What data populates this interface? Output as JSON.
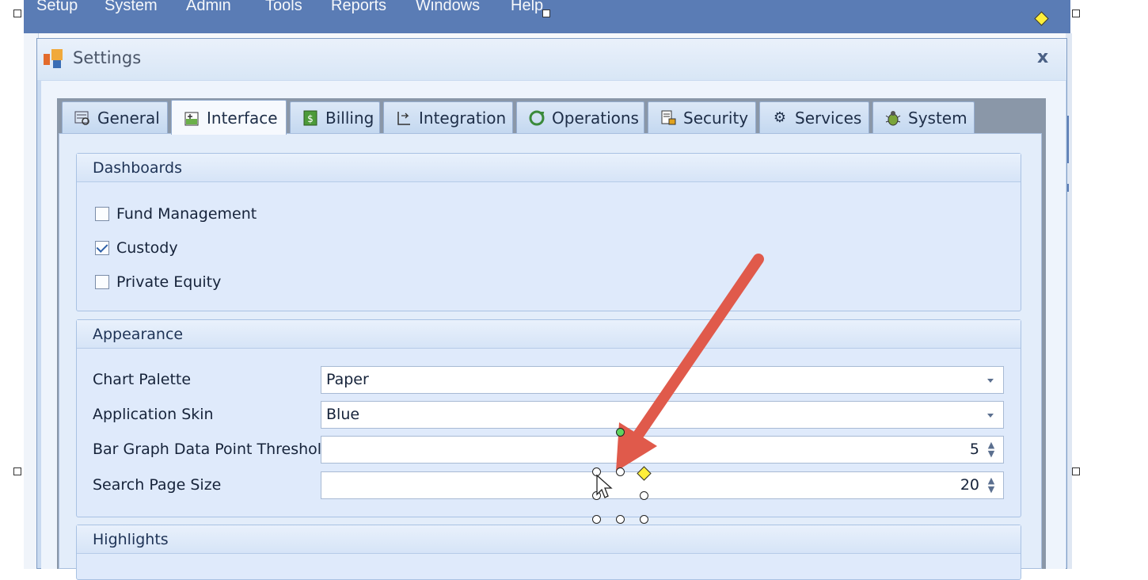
{
  "menubar": {
    "items": [
      "Setup",
      "System",
      "Admin",
      "Tools",
      "Reports",
      "Windows",
      "Help"
    ]
  },
  "dialog": {
    "title": "Settings",
    "close_glyph": "x"
  },
  "tabs": [
    {
      "label": "General",
      "icon": "general-settings-icon"
    },
    {
      "label": "Interface",
      "icon": "interface-icon",
      "active": true
    },
    {
      "label": "Billing",
      "icon": "billing-icon"
    },
    {
      "label": "Integration",
      "icon": "integration-icon"
    },
    {
      "label": "Operations",
      "icon": "operations-icon"
    },
    {
      "label": "Security",
      "icon": "security-icon"
    },
    {
      "label": "Services",
      "icon": "services-gear-icon"
    },
    {
      "label": "System",
      "icon": "system-bug-icon"
    }
  ],
  "dashboards": {
    "header": "Dashboards",
    "options": [
      {
        "label": "Fund Management",
        "checked": false
      },
      {
        "label": "Custody",
        "checked": true
      },
      {
        "label": "Private Equity",
        "checked": false
      }
    ]
  },
  "appearance": {
    "header": "Appearance",
    "chart_palette": {
      "label": "Chart Palette",
      "value": "Paper"
    },
    "application_skin": {
      "label": "Application Skin",
      "value": "Blue"
    },
    "bar_graph_threshold": {
      "label": "Bar Graph Data Point Threshold",
      "value": "5"
    },
    "search_page_size": {
      "label": "Search Page Size",
      "value": "20"
    }
  },
  "highlights": {
    "header": "Highlights"
  },
  "annotation": {
    "arrow_color": "#e05a4b"
  },
  "colors": {
    "menubar": "#5a7cb5",
    "dialog_bg": "#e3edfa",
    "accent": "#2d5fa8"
  }
}
